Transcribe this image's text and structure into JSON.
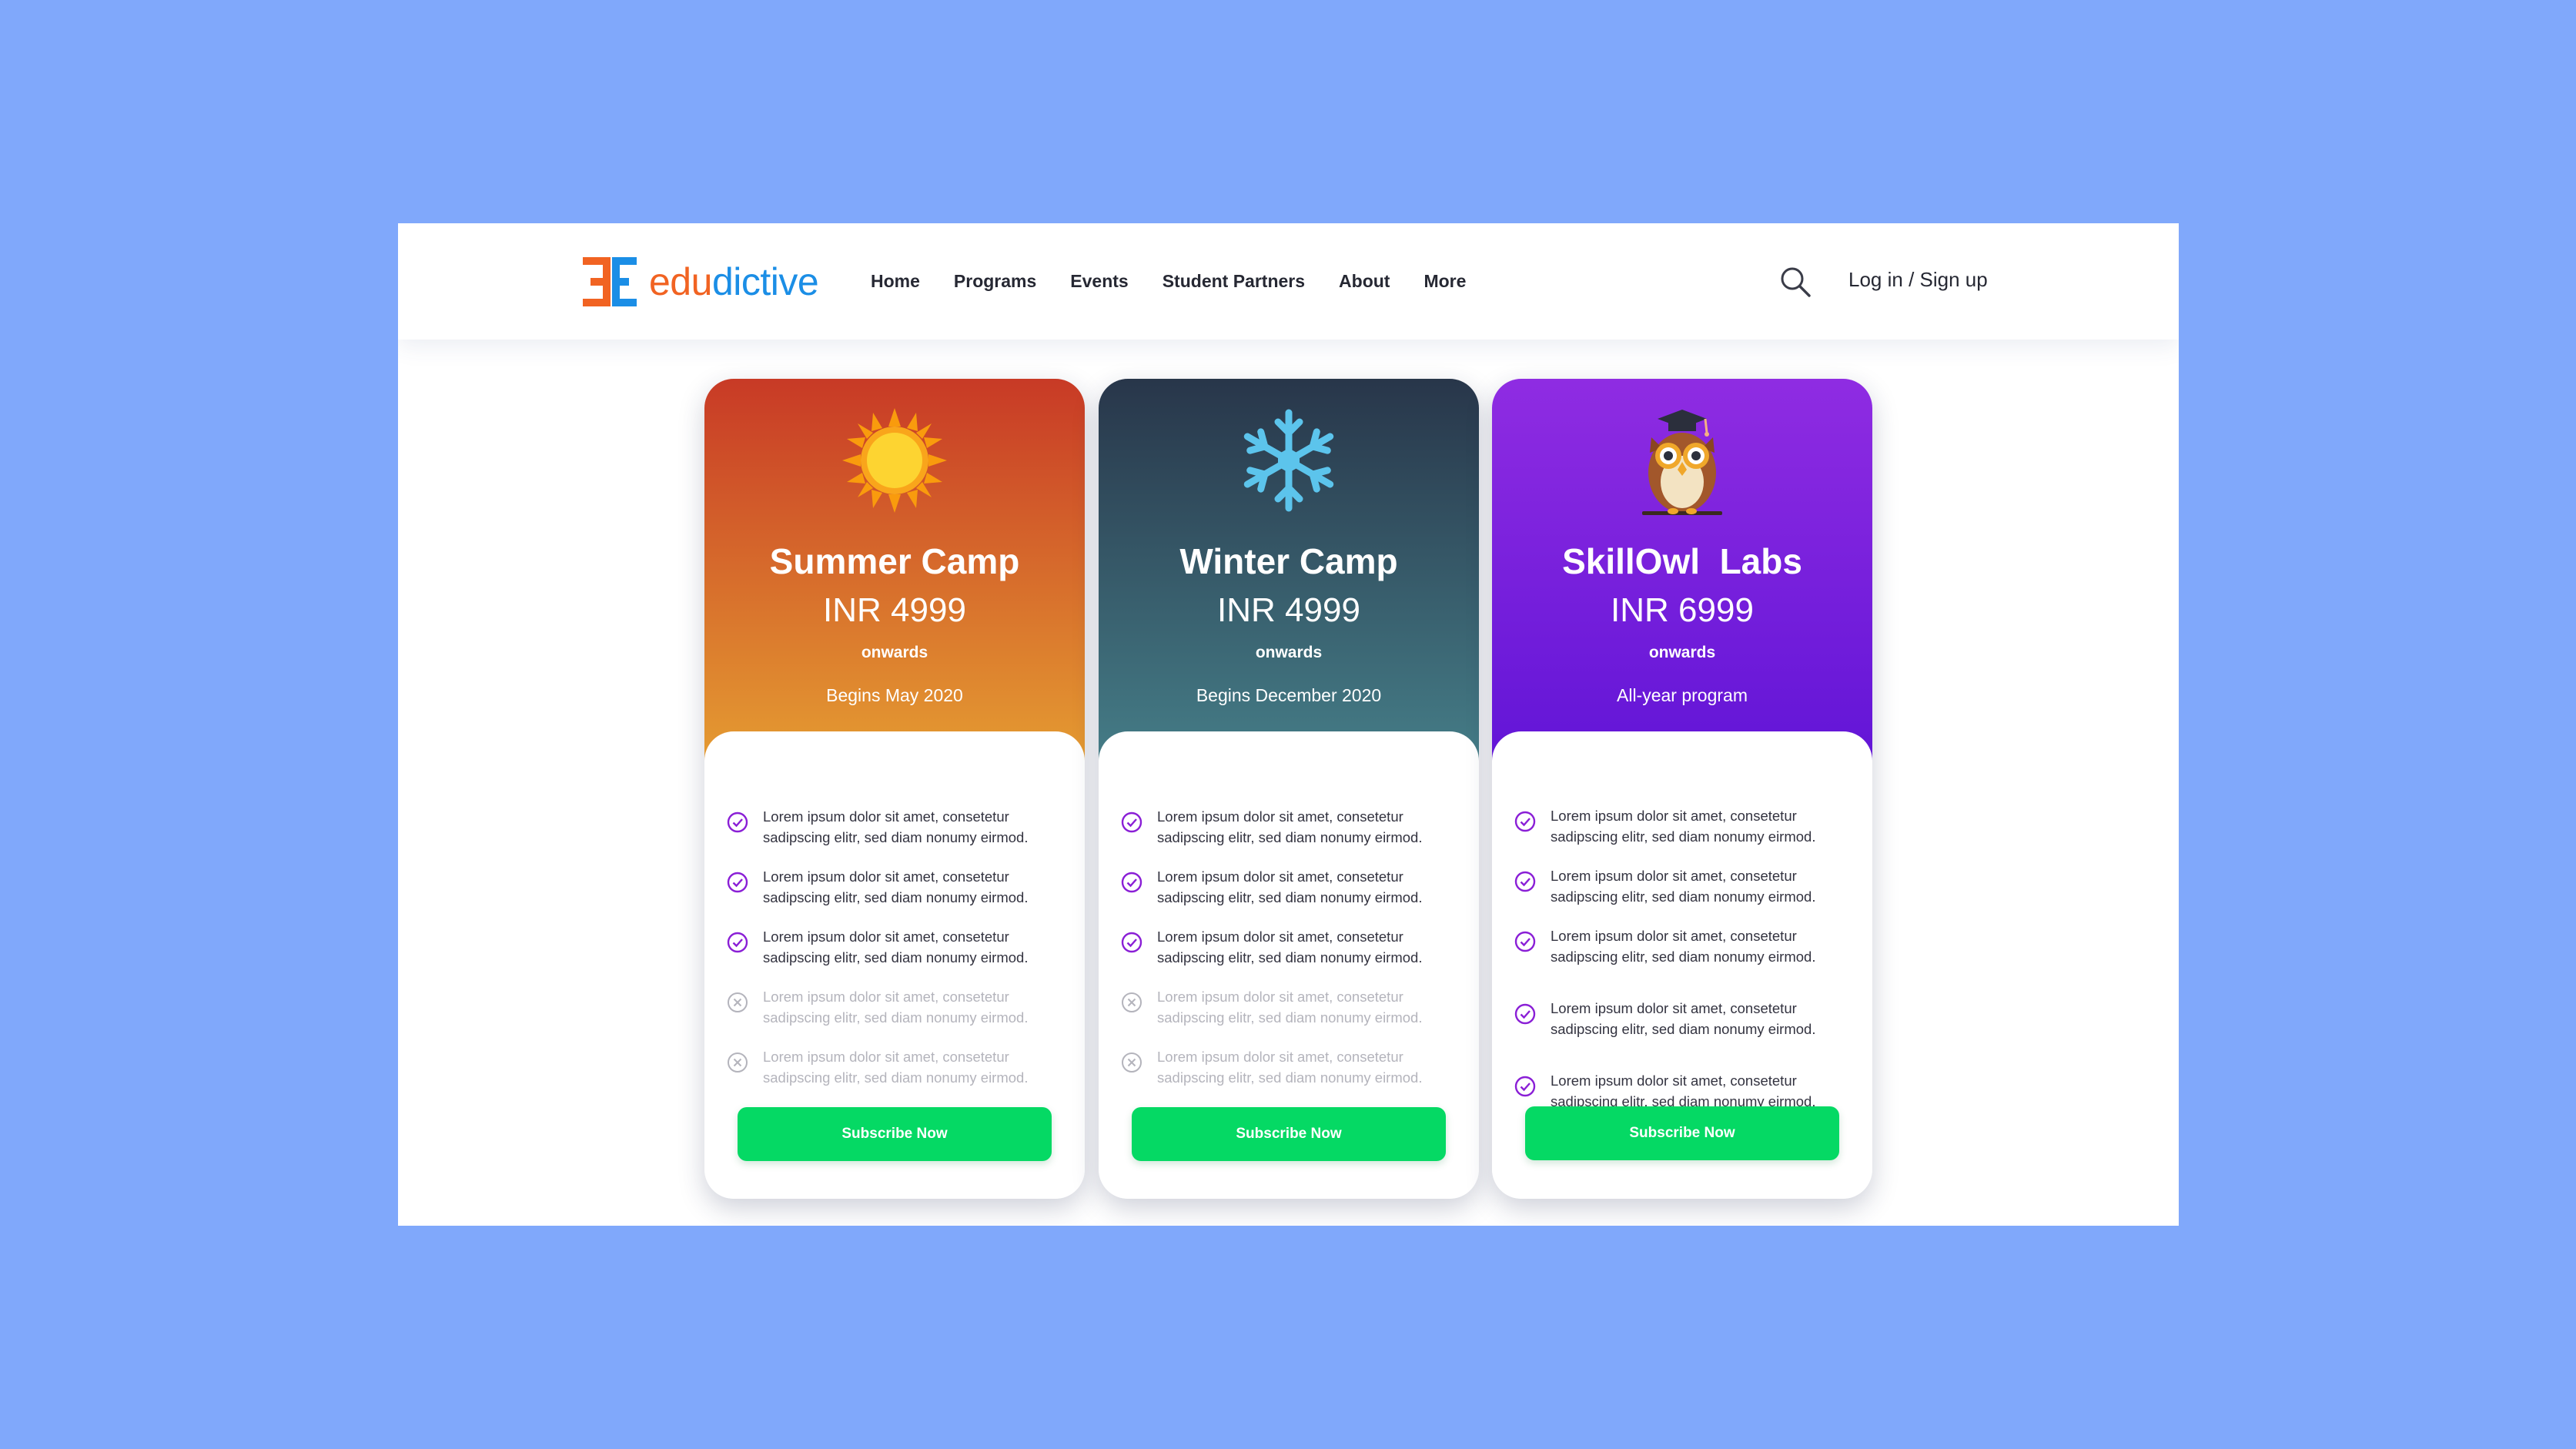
{
  "brand": {
    "name_part1": "edu",
    "name_part2": "dictive",
    "colors": {
      "orange": "#f16322",
      "blue": "#1b8ee6"
    }
  },
  "nav": {
    "items": [
      "Home",
      "Programs",
      "Events",
      "Student Partners",
      "About",
      "More"
    ],
    "search_icon": "search-icon",
    "login_label": "Log in / Sign up"
  },
  "cards": [
    {
      "title": "Summer Camp",
      "price": "INR 4999",
      "price_note": "onwards",
      "date": "Begins May 2020",
      "icon": "sun-icon",
      "gradient": [
        "#c83a26",
        "#e6a032"
      ],
      "features": [
        {
          "text": "Lorem ipsum dolor sit amet, consetetur sadipscing elitr, sed diam nonumy eirmod.",
          "included": true
        },
        {
          "text": "Lorem ipsum dolor sit amet, consetetur sadipscing elitr, sed diam nonumy eirmod.",
          "included": true
        },
        {
          "text": "Lorem ipsum dolor sit amet, consetetur sadipscing elitr, sed diam nonumy eirmod.",
          "included": true
        },
        {
          "text": "Lorem ipsum dolor sit amet, consetetur sadipscing elitr, sed diam nonumy eirmod.",
          "included": false
        },
        {
          "text": "Lorem ipsum dolor sit amet, consetetur sadipscing elitr, sed diam nonumy eirmod.",
          "included": false
        }
      ],
      "button_label": "Subscribe Now"
    },
    {
      "title": "Winter Camp",
      "price": "INR 4999",
      "price_note": "onwards",
      "date": "Begins December 2020",
      "icon": "snowflake-icon",
      "gradient": [
        "#28364a",
        "#46808a"
      ],
      "features": [
        {
          "text": "Lorem ipsum dolor sit amet, consetetur sadipscing elitr, sed diam nonumy eirmod.",
          "included": true
        },
        {
          "text": "Lorem ipsum dolor sit amet, consetetur sadipscing elitr, sed diam nonumy eirmod.",
          "included": true
        },
        {
          "text": "Lorem ipsum dolor sit amet, consetetur sadipscing elitr, sed diam nonumy eirmod.",
          "included": true
        },
        {
          "text": "Lorem ipsum dolor sit amet, consetetur sadipscing elitr, sed diam nonumy eirmod.",
          "included": false
        },
        {
          "text": "Lorem ipsum dolor sit amet, consetetur sadipscing elitr, sed diam nonumy eirmod.",
          "included": false
        }
      ],
      "button_label": "Subscribe Now"
    },
    {
      "title": "SkillOwl  Labs",
      "price": "INR 6999",
      "price_note": "onwards",
      "date": "All-year program",
      "icon": "owl-icon",
      "gradient": [
        "#8f2ce2",
        "#6014d6"
      ],
      "features": [
        {
          "text": "Lorem ipsum dolor sit amet, consetetur sadipscing elitr, sed diam nonumy eirmod.",
          "included": true
        },
        {
          "text": "Lorem ipsum dolor sit amet, consetetur sadipscing elitr, sed diam nonumy eirmod.",
          "included": true
        },
        {
          "text": "Lorem ipsum dolor sit amet, consetetur sadipscing elitr, sed diam nonumy eirmod.",
          "included": true
        },
        {
          "text": "Lorem ipsum dolor sit amet, consetetur sadipscing elitr, sed diam nonumy eirmod.",
          "included": true
        },
        {
          "text": "Lorem ipsum dolor sit amet, consetetur sadipscing elitr, sed diam nonumy eirmod.",
          "included": true
        }
      ],
      "button_label": "Subscribe Now"
    }
  ],
  "colors": {
    "page_background": "#80a8fb",
    "check": "#8a1fd6",
    "cross": "#b4b4bc",
    "subscribe_button": "#05d964"
  }
}
